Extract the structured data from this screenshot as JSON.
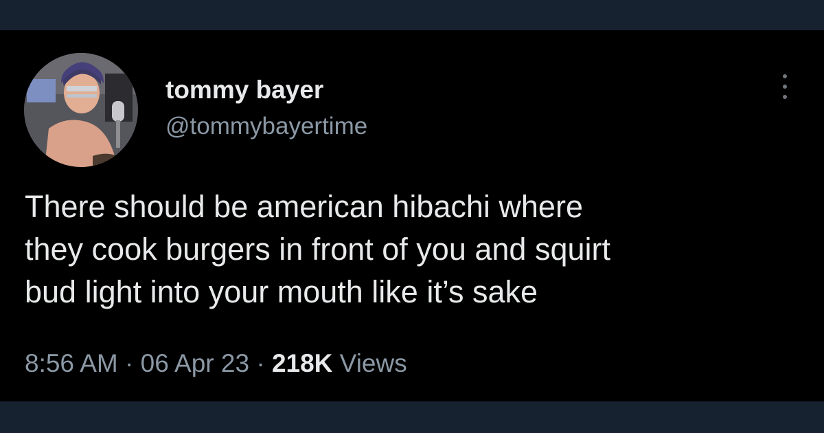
{
  "author": {
    "display_name": "tommy bayer",
    "handle": "@tommybayertime"
  },
  "tweet": {
    "text_lines": [
      "There should be american hibachi where",
      "they cook burgers in front of you and squirt",
      "bud light into your mouth like it’s sake"
    ],
    "time": "8:56 AM",
    "separator": " · ",
    "date": "06 Apr 23",
    "views_count": "218K",
    "views_label": " Views"
  },
  "icons": {
    "more": "more-vertical-icon",
    "avatar": "profile-photo"
  },
  "colors": {
    "page_background": "#172231",
    "card_background": "#000000",
    "primary_text": "#e7e9ea",
    "secondary_text": "#8b98a5"
  }
}
